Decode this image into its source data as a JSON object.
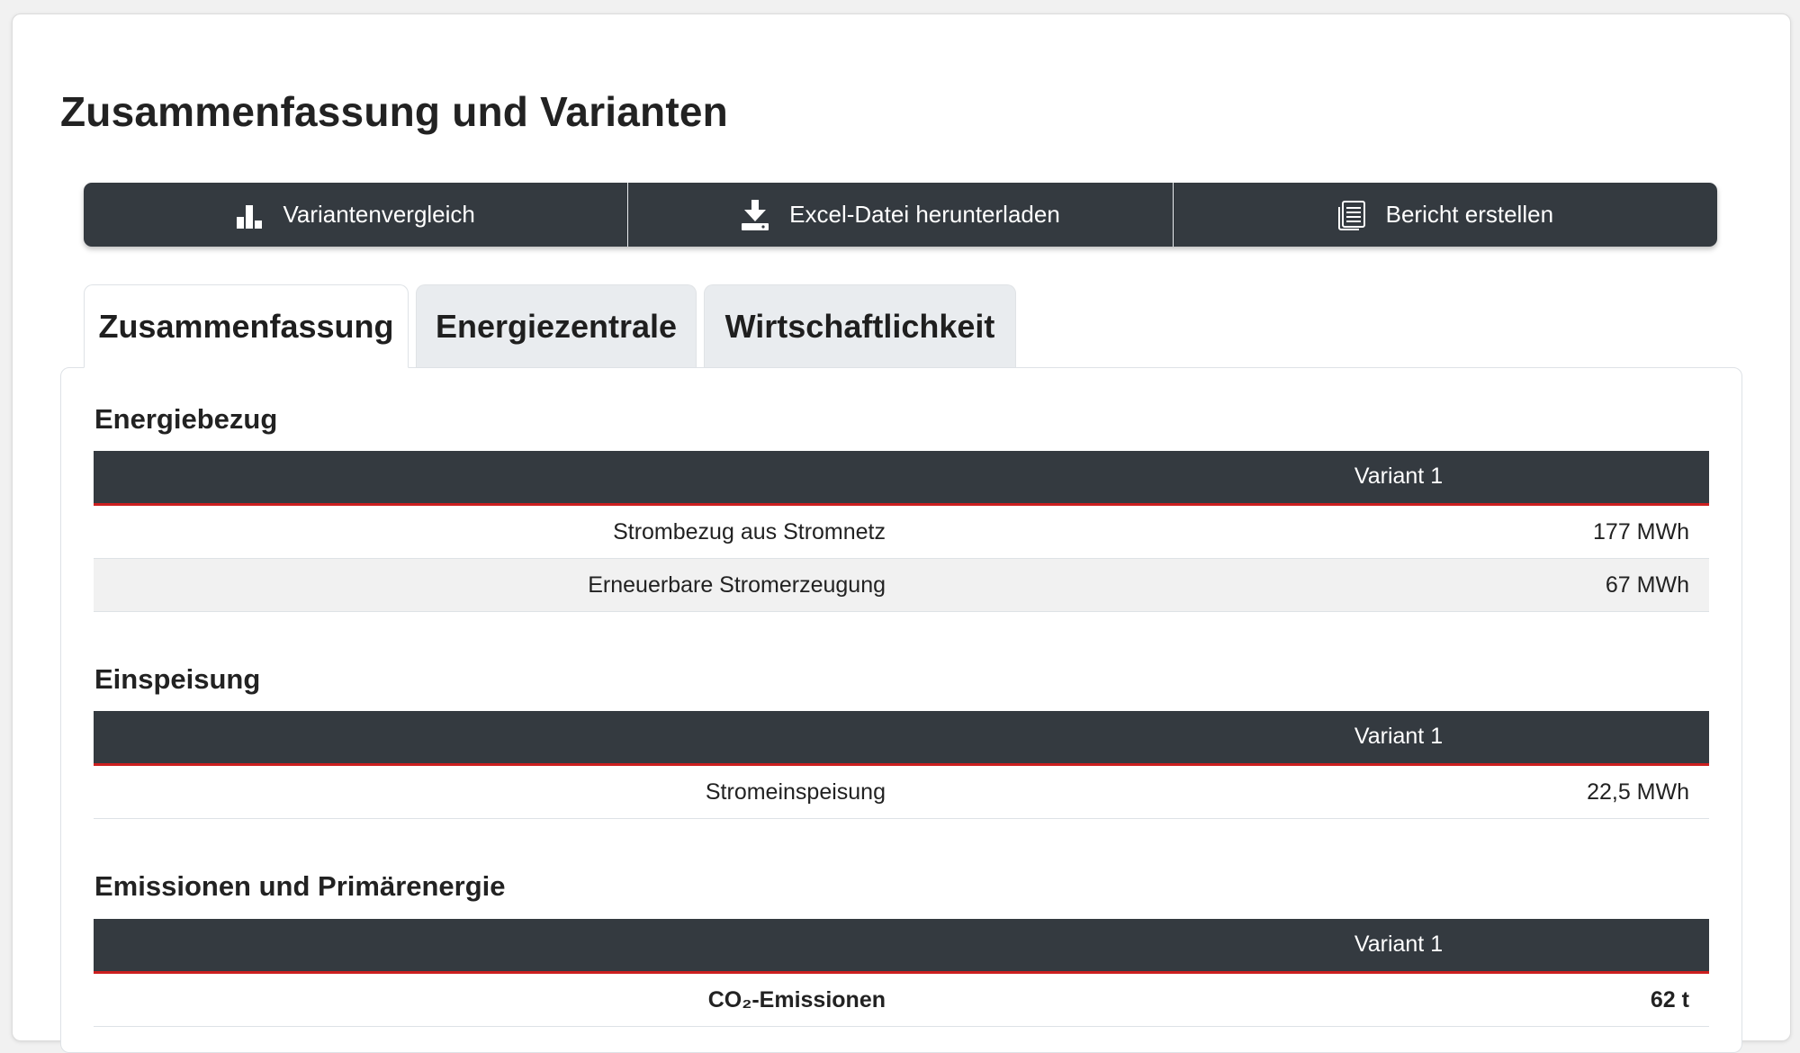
{
  "page": {
    "title": "Zusammenfassung und Varianten"
  },
  "toolbar": {
    "buttons": [
      {
        "label": "Variantenvergleich",
        "icon": "bar-chart-icon"
      },
      {
        "label": "Excel-Datei herunterladen",
        "icon": "download-icon"
      },
      {
        "label": "Bericht erstellen",
        "icon": "document-icon"
      }
    ]
  },
  "tabs": [
    {
      "label": "Zusammenfassung",
      "active": true
    },
    {
      "label": "Energiezentrale",
      "active": false
    },
    {
      "label": "Wirtschaftlichkeit",
      "active": false
    }
  ],
  "sections": [
    {
      "title": "Energiebezug",
      "column": "Variant 1",
      "rows": [
        {
          "label": "Strombezug aus Stromnetz",
          "value": "177 MWh"
        },
        {
          "label": "Erneuerbare Stromerzeugung",
          "value": "67 MWh"
        }
      ]
    },
    {
      "title": "Einspeisung",
      "column": "Variant 1",
      "rows": [
        {
          "label": "Stromeinspeisung",
          "value": "22,5 MWh"
        }
      ]
    },
    {
      "title": "Emissionen und Primärenergie",
      "column": "Variant 1",
      "rows": [
        {
          "label": "CO₂-Emissionen",
          "value": "62 t"
        }
      ]
    }
  ],
  "colors": {
    "dark": "#343a40",
    "accent_red": "#cc1f1f",
    "tab_inactive": "#e9ecef",
    "row_alt": "#f1f1f1"
  }
}
